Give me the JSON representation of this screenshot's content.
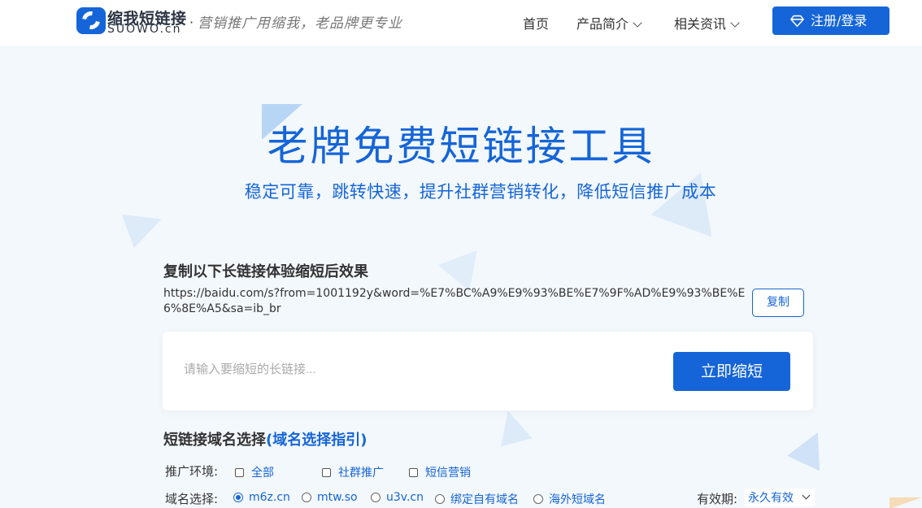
{
  "header": {
    "brand_cn": "缩我短链接",
    "brand_en": "SUOWO.cn",
    "separator": "·",
    "slogan": "营销推广用缩我，老品牌更专业",
    "nav": [
      {
        "label": "首页"
      },
      {
        "label": "产品简介"
      },
      {
        "label": "相关资讯"
      }
    ],
    "login_label": "注册/登录"
  },
  "hero": {
    "title": "老牌免费短链接工具",
    "subtitle": "稳定可靠，跳转快速，提升社群营销转化，降低短信推广成本"
  },
  "demo": {
    "title": "复制以下长链接体验缩短后效果",
    "url": "https://baidu.com/s?from=1001192y&word=%E7%BC%A9%E9%93%BE%E7%9F%AD%E9%93%BE%E6%8E%A5&sa=ib_br",
    "copy_label": "复制"
  },
  "shortener": {
    "placeholder": "请输入要缩短的长链接...",
    "button_label": "立即缩短"
  },
  "domain": {
    "title": "短链接域名选择",
    "guide": "(域名选择指引)",
    "env_label": "推广环境:",
    "env_options": [
      "全部",
      "社群推广",
      "短信营销"
    ],
    "domain_label": "域名选择:",
    "domain_options": [
      "m6z.cn",
      "mtw.so",
      "u3v.cn",
      "绑定自有域名",
      "海外短域名"
    ],
    "selected_domain": "m6z.cn",
    "validity_label": "有效期:",
    "validity_value": "永久有效"
  },
  "colors": {
    "accent": "#1565d8",
    "background": "#f3f8fd"
  }
}
